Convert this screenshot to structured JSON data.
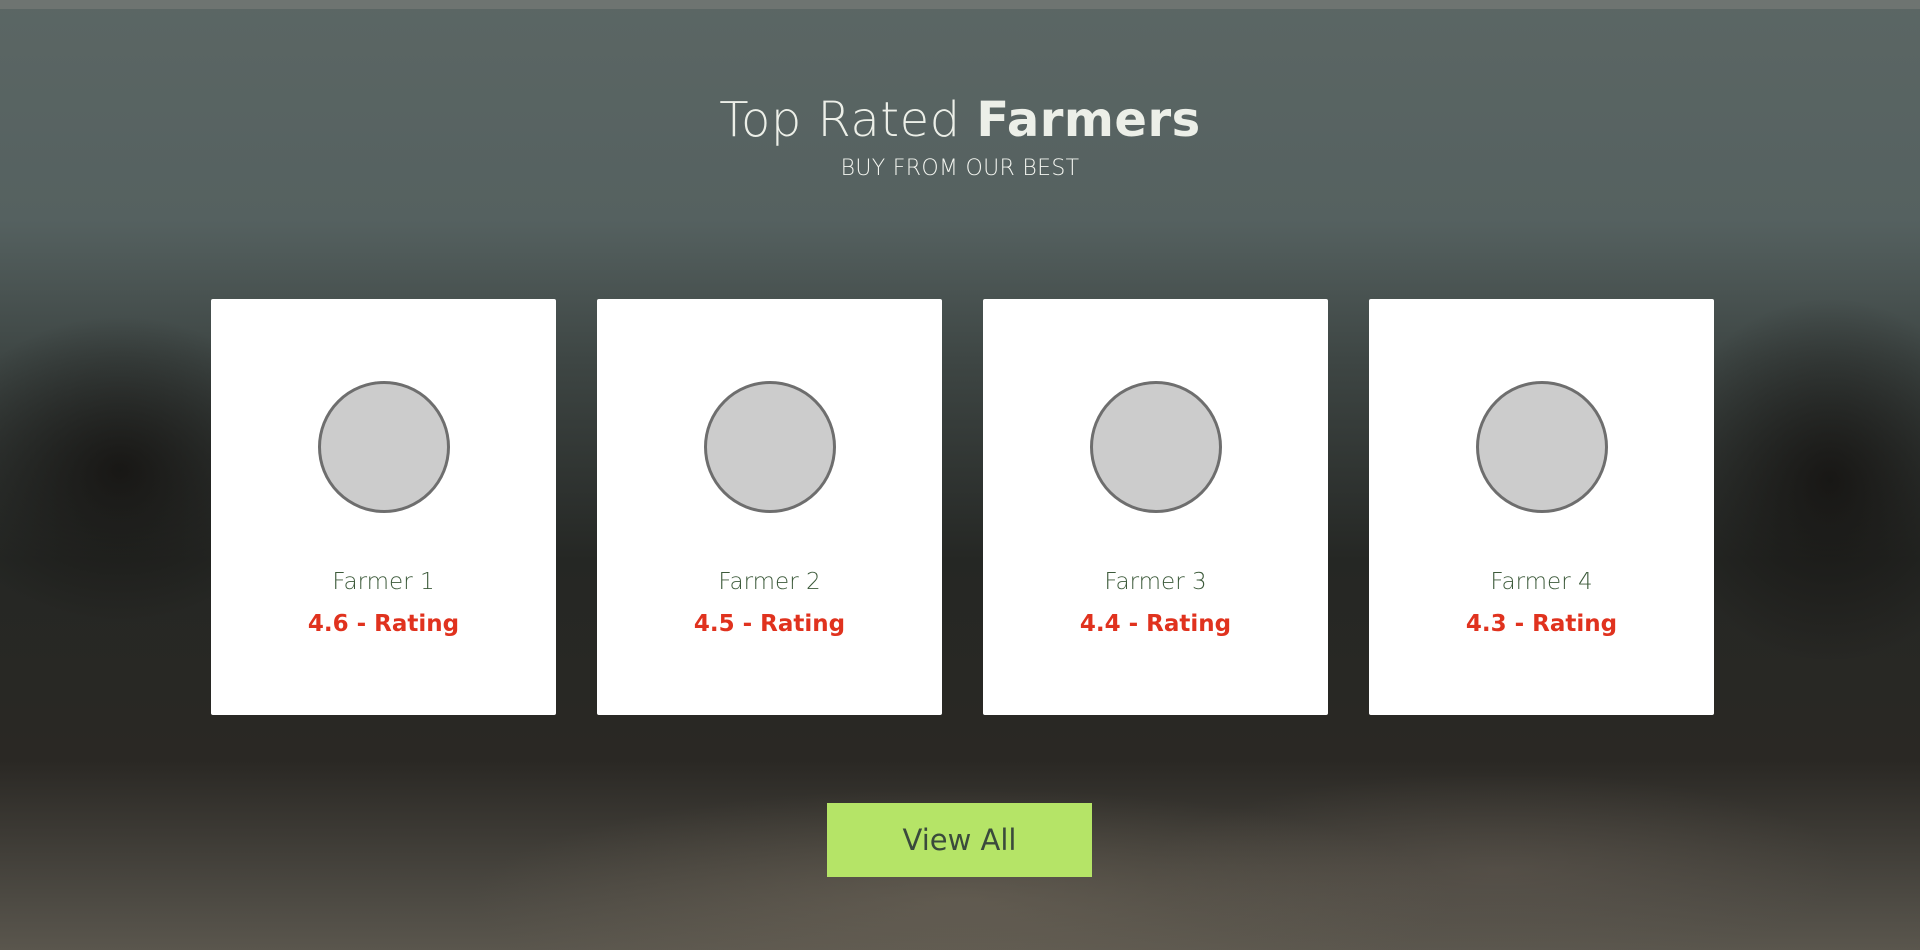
{
  "section": {
    "title_regular": "Top Rated ",
    "title_bold": "Farmers",
    "subtitle": "BUY FROM OUR BEST"
  },
  "farmers": [
    {
      "name": "Farmer 1",
      "rating": "4.6 - Rating"
    },
    {
      "name": "Farmer 2",
      "rating": "4.5 - Rating"
    },
    {
      "name": "Farmer 3",
      "rating": "4.4 - Rating"
    },
    {
      "name": "Farmer 4",
      "rating": "4.3 - Rating"
    }
  ],
  "actions": {
    "view_all_label": "View All"
  },
  "colors": {
    "rating": "#e0321e",
    "name": "#3c5a3a",
    "button": "#b5e467",
    "avatar_placeholder": "#cccccc"
  }
}
